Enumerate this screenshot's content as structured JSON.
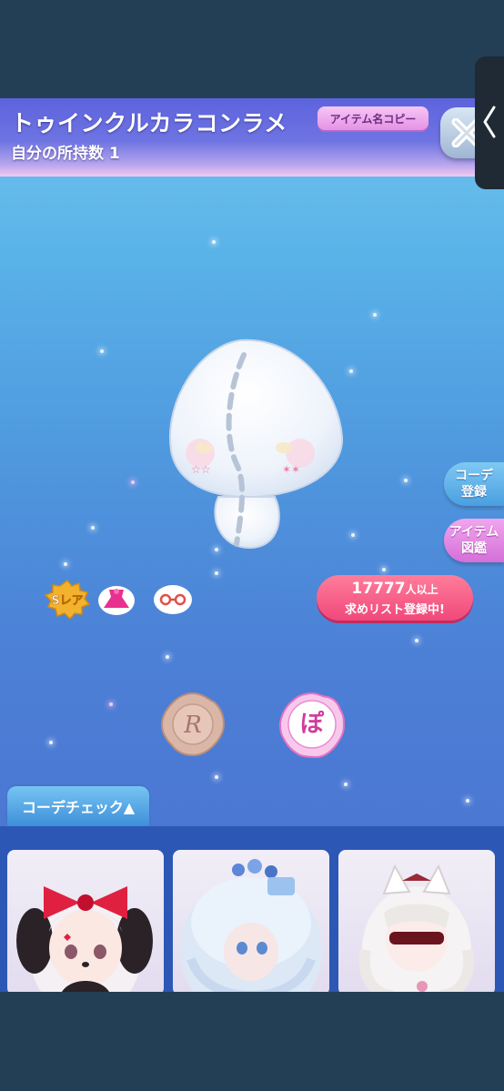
{
  "header": {
    "item_name": "トゥインクルカラコンラメ",
    "owned_text": "自分の所持数 1",
    "copy_button": "アイテム名コピー"
  },
  "side_buttons": {
    "coord_register": [
      "コーデ",
      "登録"
    ],
    "item_dictionary": [
      "アイテム",
      "図鑑"
    ]
  },
  "badges": {
    "rarity": "Sレア"
  },
  "wishlist": {
    "count": "17777",
    "count_suffix": "人以上",
    "text": "求めリスト登録中!"
  },
  "seals": {
    "left_letter": "R",
    "right_letter": "ぽ"
  },
  "coordinate_check": {
    "tab_label": "コーデチェック▲"
  },
  "colors": {
    "header": "#6e74e2",
    "wish_button": "#f0487a",
    "coord_button": "#4a9fe0",
    "dict_button": "#d56fd8"
  }
}
